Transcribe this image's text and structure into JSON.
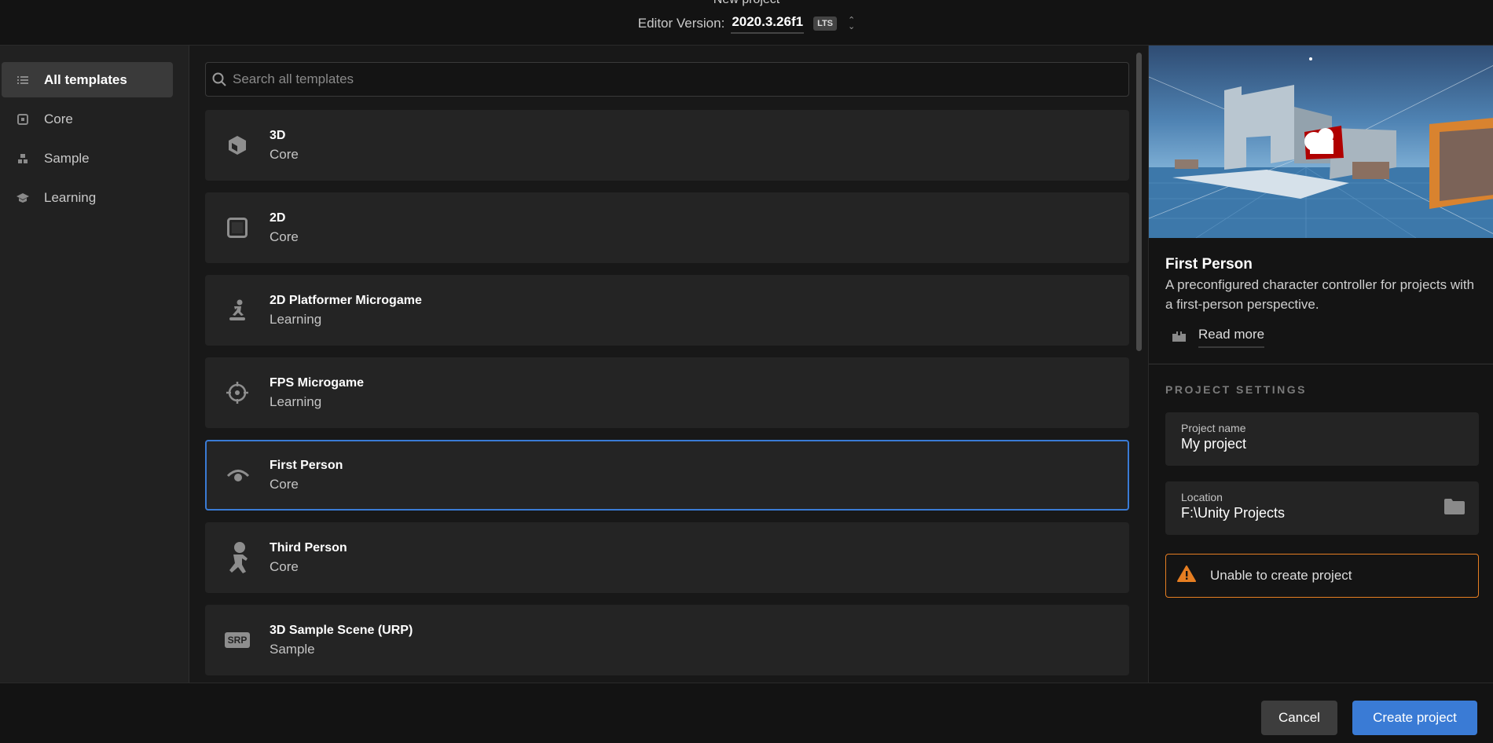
{
  "header": {
    "title": "New project",
    "version_label": "Editor Version:",
    "version": "2020.3.26f1",
    "badge": "LTS"
  },
  "sidebar": {
    "items": [
      {
        "label": "All templates",
        "icon": "list-icon",
        "active": true
      },
      {
        "label": "Core",
        "icon": "core-icon"
      },
      {
        "label": "Sample",
        "icon": "sample-icon"
      },
      {
        "label": "Learning",
        "icon": "graduation-cap-icon"
      }
    ]
  },
  "search": {
    "placeholder": "Search all templates",
    "value": ""
  },
  "templates": [
    {
      "title": "3D",
      "category": "Core",
      "icon": "cube-icon"
    },
    {
      "title": "2D",
      "category": "Core",
      "icon": "square-icon"
    },
    {
      "title": "2D Platformer Microgame",
      "category": "Learning",
      "icon": "platformer-icon"
    },
    {
      "title": "FPS Microgame",
      "category": "Learning",
      "icon": "crosshair-icon"
    },
    {
      "title": "First Person",
      "category": "Core",
      "icon": "eye-icon",
      "selected": true
    },
    {
      "title": "Third Person",
      "category": "Core",
      "icon": "person-running-icon"
    },
    {
      "title": "3D Sample Scene (URP)",
      "category": "Sample",
      "icon": "srp-icon",
      "icon_text": "SRP"
    }
  ],
  "details": {
    "title": "First Person",
    "description": "A preconfigured character controller for projects with a first-person perspective.",
    "read_more": "Read more"
  },
  "settings": {
    "heading": "PROJECT SETTINGS",
    "name_label": "Project name",
    "name_value": "My project",
    "location_label": "Location",
    "location_value": "F:\\Unity Projects",
    "warning": "Unable to create project"
  },
  "footer": {
    "cancel": "Cancel",
    "create": "Create project"
  },
  "colors": {
    "accent": "#3a7bd5",
    "warning": "#e67e22"
  }
}
